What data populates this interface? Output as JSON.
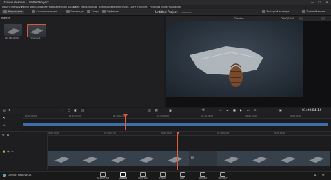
{
  "window": {
    "title": "DaVinci Resolve - Untitled Project",
    "min": "—",
    "max": "☐",
    "close": "✕"
  },
  "menu": [
    "DaVinci Resolve",
    "Файл",
    "Правка",
    "Подсветка",
    "Временная шкала",
    "Клип",
    "Маркеры",
    "Вид",
    "Воспроизведение",
    "Fusion",
    "Цвет",
    "Fairlight",
    "Рабочая область",
    "Справка"
  ],
  "toolbar": {
    "media_pool": "Медиатека",
    "sync_bin": "Синхронизация",
    "transitions": "Переходы",
    "titles": "Титры",
    "effects": "Эффекты",
    "project_title": "Untitled Project",
    "project_status": "Изменено",
    "quick_export": "Быстрый экспорт",
    "fullscreen": "Полный экран"
  },
  "mediapool": {
    "bin_label": "Master",
    "clips": [
      {
        "name": "DJI_0861.MOV"
      },
      {
        "name": "Timeline 1"
      }
    ]
  },
  "viewer": {
    "resolution": "2560/1440",
    "timeline_name": "Timeline 1",
    "timecode": "01:00:04:14"
  },
  "timeline": {
    "upper_ticks": [
      "01:00:00:00",
      "01:00:02:00",
      "01:00:04:00",
      "01:00:06:00",
      "01:00:08:00",
      "01:00:10:00",
      "01:00:12:00"
    ],
    "lower_ticks": [
      "01:00:00:00",
      "01:00:01:00",
      "01:00:02:00",
      "01:00:03:00",
      "01:00:04:00",
      "01:00:05:00",
      "01:00:06:00",
      "01:00:07:00"
    ],
    "marker": "[|]"
  },
  "footer": {
    "app": "DaVinci Resolve 18"
  },
  "pages": [
    "Медиатека",
    "Сборка",
    "Монтаж",
    "Fusion",
    "Цвет",
    "Fairlight",
    "Экспорт"
  ],
  "active_page_index": 1
}
